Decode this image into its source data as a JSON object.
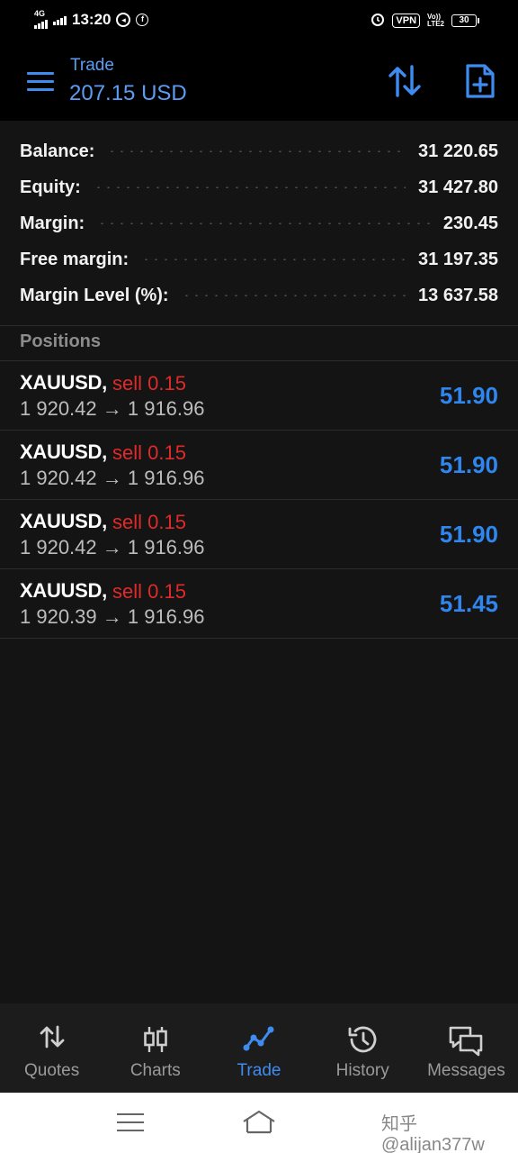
{
  "status_bar": {
    "network": "4G",
    "time": "13:20",
    "vpn": "VPN",
    "lte_top": "Vo))",
    "lte_bottom": "LTE2",
    "battery": "30"
  },
  "header": {
    "title": "Trade",
    "value": "207.15 USD",
    "accent_color": "#3f8cf0"
  },
  "summary": [
    {
      "label": "Balance:",
      "value": "31 220.65"
    },
    {
      "label": "Equity:",
      "value": "31 427.80"
    },
    {
      "label": "Margin:",
      "value": "230.45"
    },
    {
      "label": "Free margin:",
      "value": "31 197.35"
    },
    {
      "label": "Margin Level (%):",
      "value": "13 637.58"
    }
  ],
  "positions_header": "Positions",
  "positions": [
    {
      "symbol": "XAUUSD,",
      "side": "sell 0.15",
      "prices": "1 920.42 → 1 916.96",
      "profit": "51.90"
    },
    {
      "symbol": "XAUUSD,",
      "side": "sell 0.15",
      "prices": "1 920.42 → 1 916.96",
      "profit": "51.90"
    },
    {
      "symbol": "XAUUSD,",
      "side": "sell 0.15",
      "prices": "1 920.42 → 1 916.96",
      "profit": "51.90"
    },
    {
      "symbol": "XAUUSD,",
      "side": "sell 0.15",
      "prices": "1 920.39 → 1 916.96",
      "profit": "51.45"
    }
  ],
  "tabs": [
    {
      "label": "Quotes",
      "icon": "quotes-icon",
      "active": false
    },
    {
      "label": "Charts",
      "icon": "charts-icon",
      "active": false
    },
    {
      "label": "Trade",
      "icon": "trade-icon",
      "active": true
    },
    {
      "label": "History",
      "icon": "history-icon",
      "active": false
    },
    {
      "label": "Messages",
      "icon": "messages-icon",
      "active": false
    }
  ],
  "watermark": "知乎 @alijan377w",
  "colors": {
    "sell": "#e02a2a",
    "profit": "#2f86ee",
    "active_tab": "#3f8cf0"
  }
}
